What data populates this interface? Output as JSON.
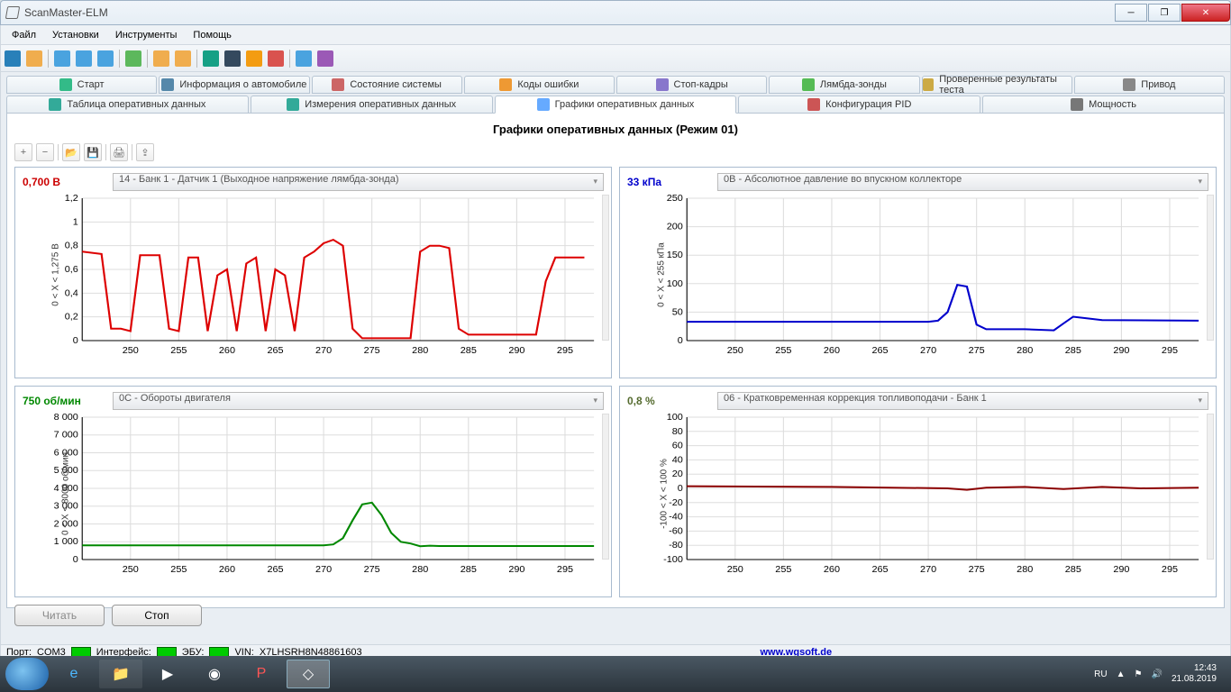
{
  "window": {
    "title": "ScanMaster-ELM"
  },
  "menubar": [
    "Файл",
    "Установки",
    "Инструменты",
    "Помощь"
  ],
  "tab_row1": [
    {
      "label": "Старт"
    },
    {
      "label": "Информация о автомобиле"
    },
    {
      "label": "Состояние системы"
    },
    {
      "label": "Коды ошибки"
    },
    {
      "label": "Стоп-кадры"
    },
    {
      "label": "Лямбда-зонды"
    },
    {
      "label": "Проверенные результаты теста"
    },
    {
      "label": "Привод"
    }
  ],
  "tab_row2": [
    {
      "label": "Таблица оперативных данных"
    },
    {
      "label": "Измерения оперативных данных"
    },
    {
      "label": "Графики оперативных данных",
      "active": true
    },
    {
      "label": "Конфигурация PID"
    },
    {
      "label": "Мощность"
    }
  ],
  "panel_title": "Графики оперативных данных (Режим 01)",
  "bottom_buttons": {
    "read": "Читать",
    "stop": "Стоп"
  },
  "statusbar": {
    "port_label": "Порт:",
    "port_value": "COM3",
    "iface_label": "Интерфейс:",
    "ecu_label": "ЭБУ:",
    "vin_label": "VIN:",
    "vin_value": "X7LHSRH8N48861603",
    "url": "www.wgsoft.de"
  },
  "tray": {
    "lang": "RU",
    "time": "12:43",
    "date": "21.08.2019"
  },
  "chart_data": [
    {
      "id": "o2",
      "value_text": "0,700 В",
      "color_class": "red",
      "stroke": "#d00",
      "pid_text": "14 - Банк 1 - Датчик 1 (Выходное напряжение лямбда-зонда)",
      "y_axis_title": "0  < X <  1,275  В",
      "type": "line",
      "x": [
        245,
        247,
        248,
        249,
        250,
        251,
        252,
        253,
        254,
        255,
        256,
        257,
        258,
        259,
        260,
        261,
        262,
        263,
        264,
        265,
        266,
        267,
        268,
        269,
        270,
        271,
        272,
        273,
        274,
        275,
        276,
        277,
        278,
        279,
        280,
        281,
        282,
        283,
        284,
        285,
        286,
        287,
        288,
        289,
        290,
        291,
        292,
        293,
        294,
        295,
        296,
        297
      ],
      "y": [
        0.75,
        0.73,
        0.1,
        0.1,
        0.08,
        0.72,
        0.72,
        0.72,
        0.1,
        0.08,
        0.7,
        0.7,
        0.08,
        0.55,
        0.6,
        0.08,
        0.65,
        0.7,
        0.08,
        0.6,
        0.55,
        0.08,
        0.7,
        0.75,
        0.82,
        0.85,
        0.8,
        0.1,
        0.02,
        0.02,
        0.02,
        0.02,
        0.02,
        0.02,
        0.75,
        0.8,
        0.8,
        0.78,
        0.1,
        0.05,
        0.05,
        0.05,
        0.05,
        0.05,
        0.05,
        0.05,
        0.05,
        0.5,
        0.7,
        0.7,
        0.7,
        0.7
      ],
      "y_ticks": [
        0,
        0.2,
        0.4,
        0.6,
        0.8,
        1,
        1.2
      ],
      "y_range": [
        0,
        1.2
      ],
      "y_tick_labels": [
        "0",
        "0,2",
        "0,4",
        "0,6",
        "0,8",
        "1",
        "1,2"
      ],
      "x_ticks": [
        250,
        255,
        260,
        265,
        270,
        275,
        280,
        285,
        290,
        295
      ],
      "x_range": [
        245,
        298
      ]
    },
    {
      "id": "map",
      "value_text": "33 кПа",
      "color_class": "blue",
      "stroke": "#00c",
      "pid_text": "0B - Абсолютное давление во впускном коллекторе",
      "y_axis_title": "0  < X <  255  кПа",
      "type": "line",
      "x": [
        245,
        270,
        271,
        272,
        273,
        274,
        275,
        276,
        277,
        278,
        280,
        283,
        284,
        285,
        286,
        287,
        288,
        298
      ],
      "y": [
        33,
        33,
        35,
        50,
        98,
        95,
        28,
        20,
        20,
        20,
        20,
        18,
        30,
        42,
        40,
        38,
        36,
        35
      ],
      "y_ticks": [
        0,
        50,
        100,
        150,
        200,
        250
      ],
      "y_range": [
        0,
        250
      ],
      "y_tick_labels": [
        "0",
        "50",
        "100",
        "150",
        "200",
        "250"
      ],
      "x_ticks": [
        250,
        255,
        260,
        265,
        270,
        275,
        280,
        285,
        290,
        295
      ],
      "x_range": [
        245,
        298
      ]
    },
    {
      "id": "rpm",
      "value_text": "750 об/мин",
      "color_class": "green",
      "stroke": "#080",
      "pid_text": "0C - Обороты двигателя",
      "y_axis_title": "0  < X <  8000  об/мин",
      "type": "line",
      "x": [
        245,
        270,
        271,
        272,
        273,
        274,
        275,
        276,
        277,
        278,
        279,
        280,
        281,
        282,
        298
      ],
      "y": [
        800,
        800,
        850,
        1200,
        2200,
        3100,
        3200,
        2500,
        1500,
        1000,
        900,
        750,
        780,
        760,
        760
      ],
      "y_ticks": [
        0,
        1000,
        2000,
        3000,
        4000,
        5000,
        6000,
        7000,
        8000
      ],
      "y_range": [
        0,
        8000
      ],
      "y_tick_labels": [
        "0",
        "1 000",
        "2 000",
        "3 000",
        "4 000",
        "5 000",
        "6 000",
        "7 000",
        "8 000"
      ],
      "x_ticks": [
        250,
        255,
        260,
        265,
        270,
        275,
        280,
        285,
        290,
        295
      ],
      "x_range": [
        245,
        298
      ]
    },
    {
      "id": "stft",
      "value_text": "0,8 %",
      "color_class": "olive",
      "stroke": "#8b0000",
      "pid_text": "06 - Кратковременная коррекция топливоподачи - Банк 1",
      "y_axis_title": "-100  < X <  100  %",
      "type": "line",
      "x": [
        245,
        260,
        272,
        274,
        276,
        280,
        284,
        288,
        292,
        298
      ],
      "y": [
        3,
        2,
        0,
        -2,
        1,
        2,
        -1,
        2,
        0,
        1
      ],
      "y_ticks": [
        -100,
        -80,
        -60,
        -40,
        -20,
        0,
        20,
        40,
        60,
        80,
        100
      ],
      "y_range": [
        -100,
        100
      ],
      "y_tick_labels": [
        "-100",
        "-80",
        "-60",
        "-40",
        "-20",
        "0",
        "20",
        "40",
        "60",
        "80",
        "100"
      ],
      "x_ticks": [
        250,
        255,
        260,
        265,
        270,
        275,
        280,
        285,
        290,
        295
      ],
      "x_range": [
        245,
        298
      ]
    }
  ]
}
